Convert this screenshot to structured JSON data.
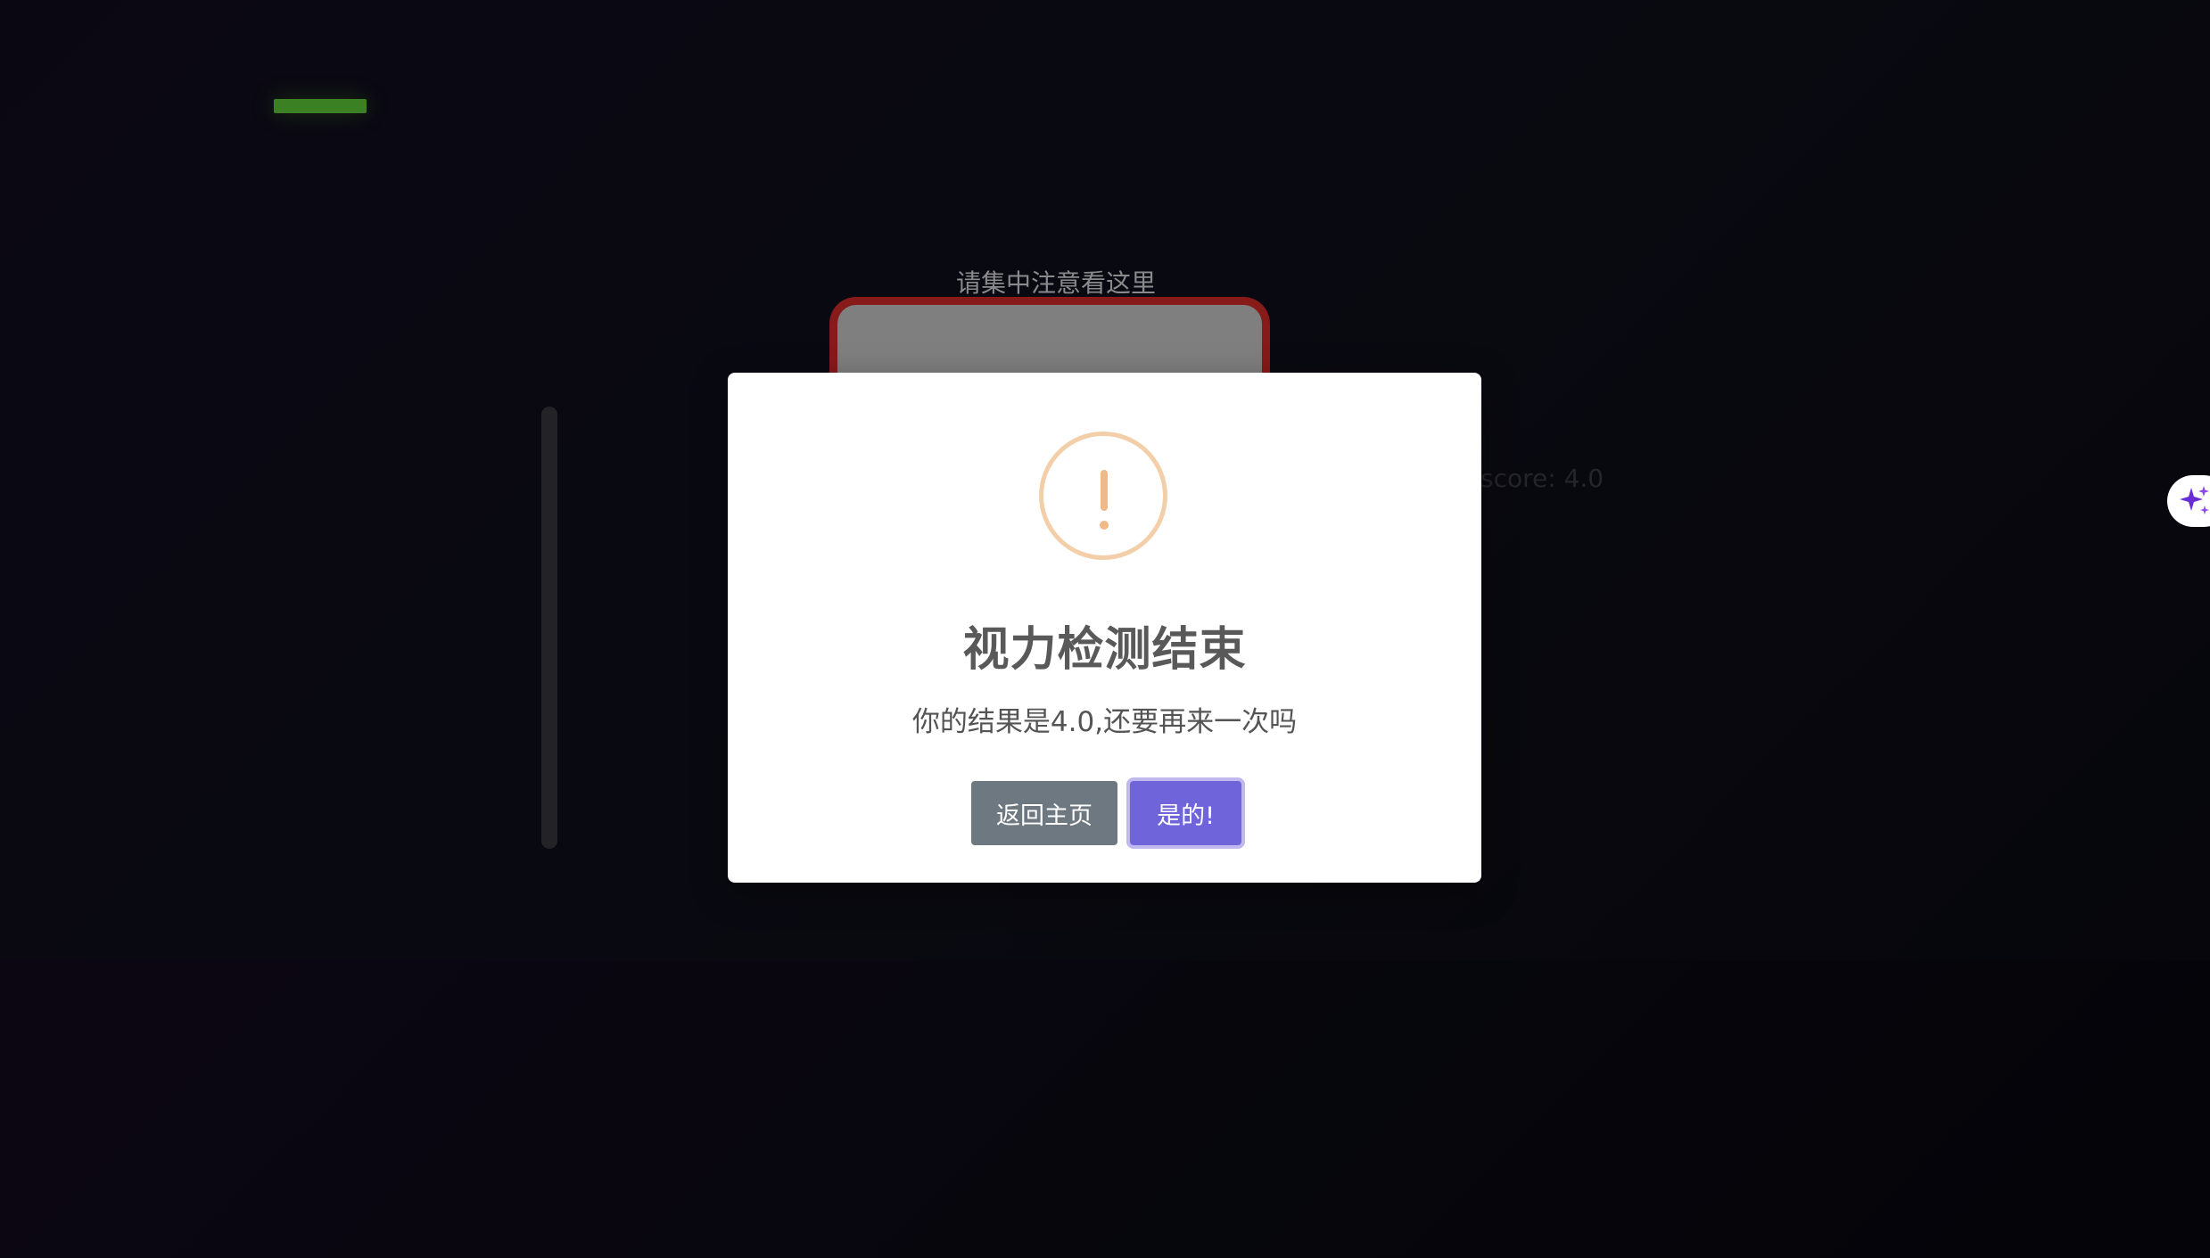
{
  "background": {
    "hint_text": "请集中注意看这里",
    "score_text": "score: 4.0"
  },
  "dialog": {
    "title": "视力检测结束",
    "message": "你的结果是4.0,还要再来一次吗",
    "cancel_label": "返回主页",
    "confirm_label": "是的!"
  },
  "colors": {
    "confirm": "#7064da",
    "cancel": "#6e7881",
    "warning_icon": "#f0b985",
    "progress": "#4a9d2c",
    "test_card_border": "#a4221f"
  },
  "icons": {
    "warning": "exclamation-circle-icon",
    "assistant": "sparkles-icon"
  }
}
